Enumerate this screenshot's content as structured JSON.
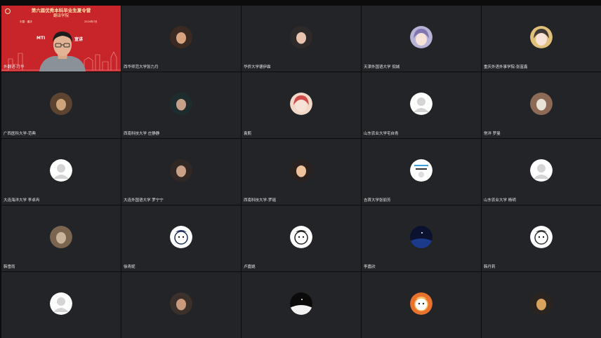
{
  "presenter": {
    "banner_title": "第六届优秀本科毕业生夏令营",
    "banner_subtitle": "翻译学院",
    "banner_location": "中国 · 重庆",
    "banner_date": "2024年7月",
    "talk_left": "MTI",
    "talk_right": "宣讲",
    "name": "外翻语-月华"
  },
  "participants": [
    {
      "name": "西华师范大学张力月",
      "avatar": "photo-avatar-icon"
    },
    {
      "name": "华侨大学德伊霖",
      "avatar": "photo-avatar-icon"
    },
    {
      "name": "天津外国语大学 倪城",
      "avatar": "anime-avatar-icon"
    },
    {
      "name": "重庆外语外事学院-张富鑫",
      "avatar": "anime-avatar-icon"
    },
    {
      "name": "广西医科大学-范典",
      "avatar": "photo-avatar-icon"
    },
    {
      "name": "西南科技大学 庄静静",
      "avatar": "photo-avatar-icon"
    },
    {
      "name": "袁熙",
      "avatar": "anime-avatar-icon"
    },
    {
      "name": "山东农业大学宅自青",
      "avatar": "default-user-icon"
    },
    {
      "name": "常洋 罗曼",
      "avatar": "photo-avatar-icon"
    },
    {
      "name": "大连海洋大学 李卓冉",
      "avatar": "default-user-icon"
    },
    {
      "name": "大连外国语大学 罗宁宁",
      "avatar": "photo-avatar-icon"
    },
    {
      "name": "西南科技大学-罗瑶",
      "avatar": "photo-avatar-icon"
    },
    {
      "name": "吉首大学张丽芳",
      "avatar": "sticker-avatar-icon"
    },
    {
      "name": "山东农业大学 杨明",
      "avatar": "default-user-icon"
    },
    {
      "name": "韩雪雨",
      "avatar": "photo-avatar-icon"
    },
    {
      "name": "徐青妮",
      "avatar": "cartoon-avatar-icon"
    },
    {
      "name": "卢嘉姚",
      "avatar": "cartoon-avatar-icon"
    },
    {
      "name": "李嘉欣",
      "avatar": "night-sky-avatar-icon"
    },
    {
      "name": "韩丹莉",
      "avatar": "cartoon-avatar-icon"
    },
    {
      "name": "",
      "avatar": "default-user-icon"
    },
    {
      "name": "",
      "avatar": "photo-avatar-icon"
    },
    {
      "name": "",
      "avatar": "night-sky-avatar-icon"
    },
    {
      "name": "",
      "avatar": "cartoon-avatar-icon"
    },
    {
      "name": "",
      "avatar": "photo-avatar-icon"
    }
  ]
}
